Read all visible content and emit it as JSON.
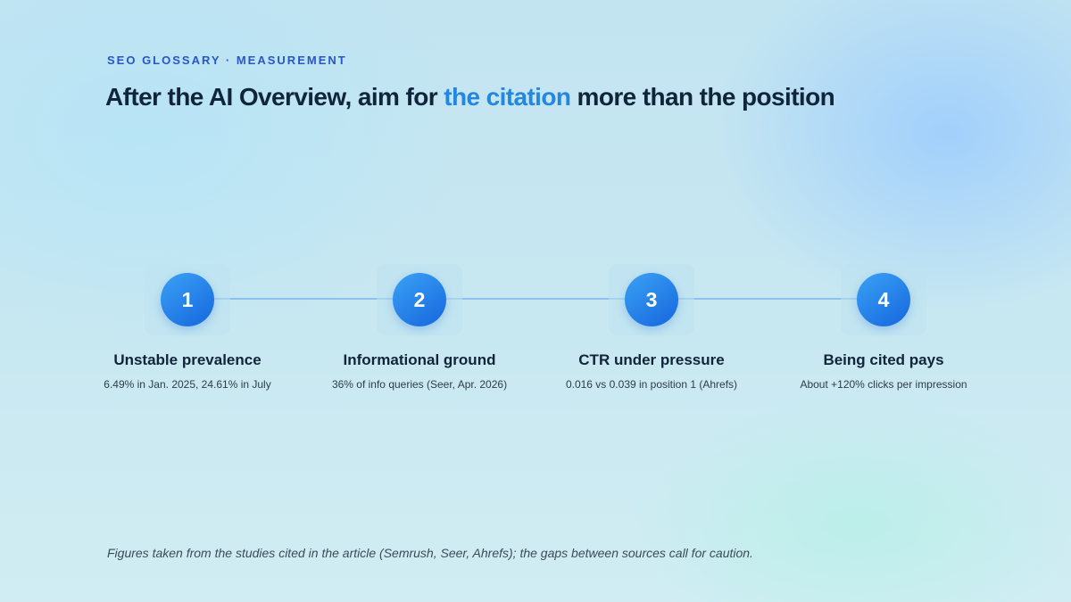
{
  "header": {
    "kicker": "SEO GLOSSARY · MEASUREMENT",
    "title_before": "After the AI Overview, aim for ",
    "title_accent": "the citation",
    "title_after": " more than the position"
  },
  "steps": [
    {
      "number": "1",
      "title": "Unstable prevalence",
      "description": "6.49% in Jan. 2025, 24.61% in July"
    },
    {
      "number": "2",
      "title": "Informational ground",
      "description": "36% of info queries (Seer, Apr. 2026)"
    },
    {
      "number": "3",
      "title": "CTR under pressure",
      "description": "0.016 vs 0.039 in position 1 (Ahrefs)"
    },
    {
      "number": "4",
      "title": "Being cited pays",
      "description": "About +120% clicks per impression"
    }
  ],
  "footnote": "Figures taken from the studies cited in the article (Semrush, Seer, Ahrefs); the gaps between sources call for caution.",
  "colors": {
    "accent": "#2387e0",
    "kicker": "#2a56c4",
    "circle_start": "#3aa2f6",
    "circle_end": "#1666dd",
    "connector": "#8cc0ee"
  }
}
